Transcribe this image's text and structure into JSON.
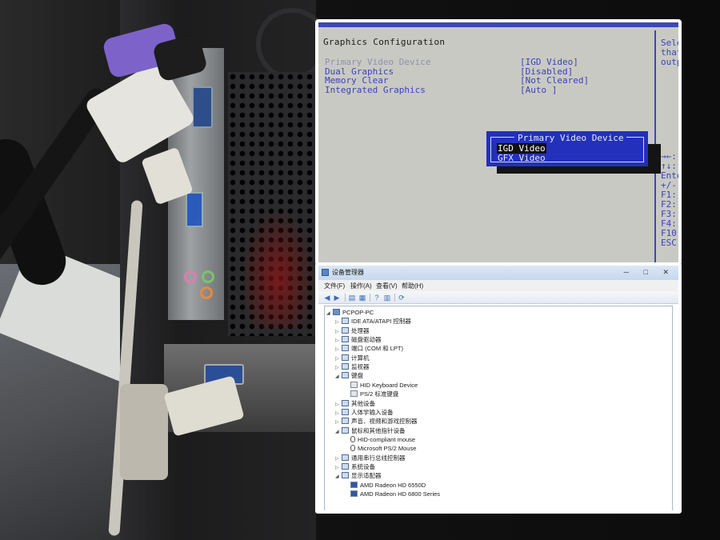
{
  "bios": {
    "title": "Graphics Configuration",
    "items": [
      {
        "label": "Primary Video Device",
        "value": "[IGD Video]"
      },
      {
        "label": "Dual Graphics",
        "value": "[Disabled]"
      },
      {
        "label": "Memory Clear",
        "value": "[Not Cleared]"
      },
      {
        "label": "Integrated Graphics",
        "value": "[Auto ]"
      }
    ],
    "help": [
      "Sele",
      "that",
      "outp",
      "→←:",
      "↑↓:",
      "Ente",
      "+/-:",
      "F1:",
      "F2:",
      "F3:",
      "F4: S",
      "F10:",
      "ESC:"
    ],
    "popup": {
      "title": "Primary Video Device",
      "options": [
        "IGD Video",
        "GFX Video"
      ],
      "selected": "IGD Video"
    }
  },
  "device_manager": {
    "window_title": "设备管理器",
    "window_buttons": "─ □ ✕",
    "menu": [
      "文件(F)",
      "操作(A)",
      "查看(V)",
      "帮助(H)"
    ],
    "toolbar_icons": [
      "back-arrow-icon",
      "forward-arrow-icon",
      "properties-icon",
      "list-icon",
      "help-icon",
      "grid-icon",
      "scan-hardware-icon"
    ],
    "toolbar_glyphs": [
      "◀",
      "▶",
      "▤",
      "▦",
      "?",
      "▥",
      "⟳"
    ],
    "tree": [
      {
        "label": "PCPOP-PC",
        "level": 0,
        "expanded": true,
        "icon": "computer-icon"
      },
      {
        "label": "IDE ATA/ATAPI 控制器",
        "level": 1,
        "expanded": false,
        "icon": "ide-controller-icon"
      },
      {
        "label": "处理器",
        "level": 1,
        "expanded": false,
        "icon": "processor-icon"
      },
      {
        "label": "磁盘驱动器",
        "level": 1,
        "expanded": false,
        "icon": "disk-drive-icon"
      },
      {
        "label": "端口 (COM 和 LPT)",
        "level": 1,
        "expanded": false,
        "icon": "port-icon"
      },
      {
        "label": "计算机",
        "level": 1,
        "expanded": false,
        "icon": "computer-icon"
      },
      {
        "label": "监视器",
        "level": 1,
        "expanded": false,
        "icon": "monitor-icon"
      },
      {
        "label": "键盘",
        "level": 1,
        "expanded": true,
        "icon": "keyboard-icon"
      },
      {
        "label": "HID Keyboard Device",
        "level": 2,
        "expanded": null,
        "icon": "keyboard-device-icon"
      },
      {
        "label": "PS/2 标准键盘",
        "level": 2,
        "expanded": null,
        "icon": "keyboard-device-icon"
      },
      {
        "label": "其他设备",
        "level": 1,
        "expanded": false,
        "icon": "other-devices-icon"
      },
      {
        "label": "人体学输入设备",
        "level": 1,
        "expanded": false,
        "icon": "hid-icon"
      },
      {
        "label": "声音、视频和游戏控制器",
        "level": 1,
        "expanded": false,
        "icon": "sound-icon"
      },
      {
        "label": "鼠标和其他指针设备",
        "level": 1,
        "expanded": true,
        "icon": "mouse-icon"
      },
      {
        "label": "HID-compliant mouse",
        "level": 2,
        "expanded": null,
        "icon": "mouse-device-icon"
      },
      {
        "label": "Microsoft PS/2 Mouse",
        "level": 2,
        "expanded": null,
        "icon": "mouse-device-icon"
      },
      {
        "label": "通用串行总线控制器",
        "level": 1,
        "expanded": false,
        "icon": "usb-icon"
      },
      {
        "label": "系统设备",
        "level": 1,
        "expanded": false,
        "icon": "system-devices-icon"
      },
      {
        "label": "显示适配器",
        "level": 1,
        "expanded": true,
        "icon": "display-adapter-icon"
      },
      {
        "label": "AMD Radeon HD 6550D",
        "level": 2,
        "expanded": null,
        "icon": "gpu-device-icon"
      },
      {
        "label": "AMD Radeon HD 6800 Series",
        "level": 2,
        "expanded": null,
        "icon": "gpu-device-icon"
      }
    ]
  }
}
